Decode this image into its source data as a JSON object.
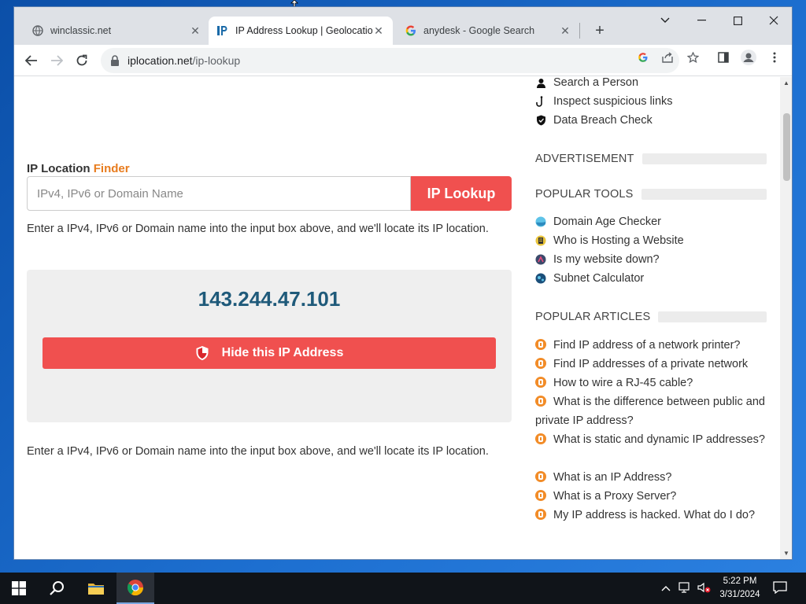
{
  "browser": {
    "tabs": [
      {
        "title": "winclassic.net",
        "favicon": "globe-icon",
        "active": false
      },
      {
        "title": "IP Address Lookup | Geolocation",
        "favicon": "iplocation-favicon",
        "active": true
      },
      {
        "title": "anydesk - Google Search",
        "favicon": "google-icon",
        "active": false
      }
    ],
    "url_host": "iplocation.net",
    "url_path": "/ip-lookup"
  },
  "finder": {
    "title_main": "IP Location",
    "title_accent": "Finder",
    "input_placeholder": "IPv4, IPv6 or Domain Name",
    "button_label": "IP Lookup",
    "help_text_1": "Enter a IPv4, IPv6 or Domain name into the input box above, and we'll locate its IP location.",
    "help_text_2": "Enter a IPv4, IPv6 or Domain name into the input box above, and we'll locate its IP location."
  },
  "ip_box": {
    "ip_address": "143.244.47.101",
    "hide_button_label": "Hide this IP Address"
  },
  "sidebar": {
    "top_links": [
      {
        "label": "Search a Person",
        "icon": "person-icon"
      },
      {
        "label": "Inspect suspicious links",
        "icon": "hook-icon"
      },
      {
        "label": "Data Breach Check",
        "icon": "shield-icon"
      }
    ],
    "advertisement_heading": "ADVERTISEMENT",
    "tools_heading": "POPULAR TOOLS",
    "tools": [
      {
        "label": "Domain Age Checker",
        "icon": "globe-icon"
      },
      {
        "label": "Who is Hosting a Website",
        "icon": "server-icon"
      },
      {
        "label": "Is my website down?",
        "icon": "status-icon"
      },
      {
        "label": "Subnet Calculator",
        "icon": "network-icon"
      }
    ],
    "articles_heading": "POPULAR ARTICLES",
    "articles": [
      "Find IP address of a network printer?",
      "Find IP addresses of a private network",
      "How to wire a RJ-45 cable?",
      "What is the difference between public and private IP address?",
      "What is static and dynamic IP addresses?",
      "What is an IP Address?",
      "What is a Proxy Server?",
      "My IP address is hacked. What do I do?"
    ]
  },
  "taskbar": {
    "time": "5:22 PM",
    "date": "3/31/2024"
  },
  "colors": {
    "accent_red": "#f0504f",
    "accent_orange": "#e87c1e",
    "ip_text": "#1f5a7a"
  }
}
